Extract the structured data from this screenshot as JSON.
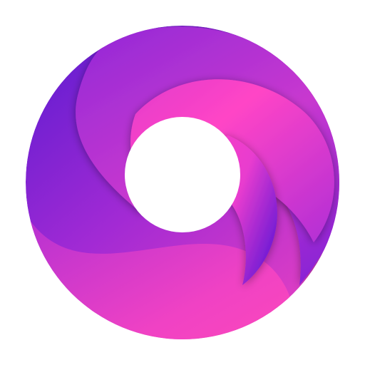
{
  "logo": {
    "icon_name": "ring-swirl-logo-icon",
    "background_color": "#ffffff",
    "colors": {
      "deep_violet": "#6c1fd1",
      "purple": "#9b2ad8",
      "magenta": "#c836c9",
      "hot_pink": "#ff45c6",
      "bright_pink": "#ff3fbf",
      "center_hole": "#ffffff"
    }
  }
}
